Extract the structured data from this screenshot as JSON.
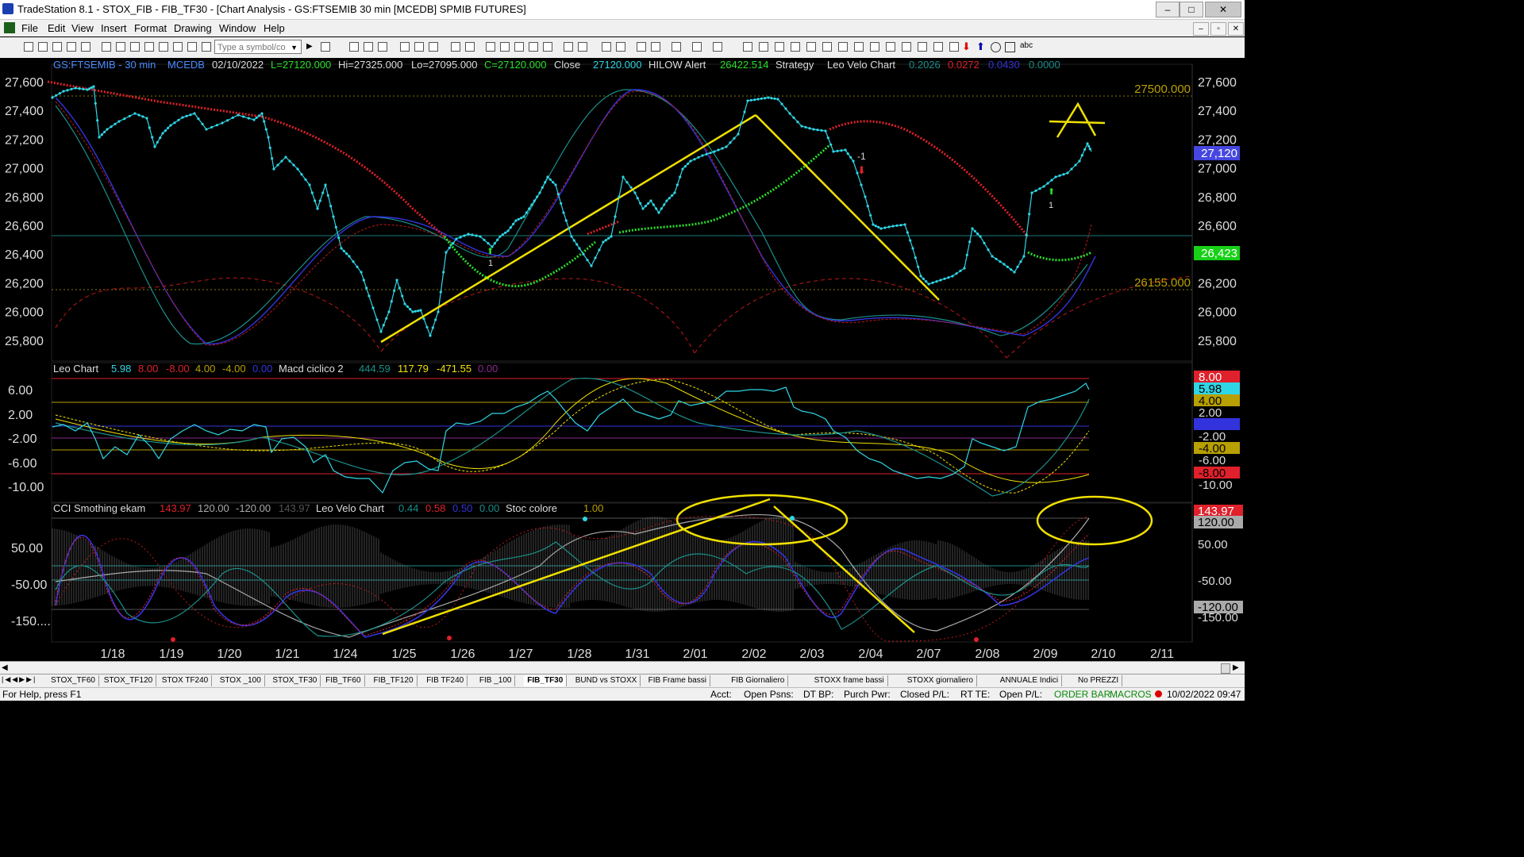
{
  "window": {
    "title": "TradeStation 8.1 - STOX_FIB - FIB_TF30 - [Chart Analysis - GS:FTSEMIB  30 min  [MCEDB] SPMIB FUTURES]",
    "min": "–",
    "max": "□",
    "close": "✕"
  },
  "menu": [
    "File",
    "Edit",
    "View",
    "Insert",
    "Format",
    "Drawing",
    "Window",
    "Help"
  ],
  "toolbar": {
    "symbol_placeholder": "Type a symbol/co",
    "abc": "abc"
  },
  "header": {
    "symbol": "GS:FTSEMIB - 30 min",
    "data": "MCEDB",
    "date": "02/10/2022",
    "last": "L=27120.000",
    "hi": "Hi=27325.000",
    "lo": "Lo=27095.000",
    "close_val": "C=27120.000",
    "close_label": "Close",
    "close_num": "27120.000",
    "hilow": "HILOW Alert",
    "hilow_val": "26422.514",
    "strategy": "Strategy",
    "leo_velo": "Leo Velo Chart",
    "v1": "0.2026",
    "v2": "0.0272",
    "v3": "0.0430",
    "v4": "0.0000"
  },
  "price_axis": [
    "27,600",
    "27,400",
    "27,200",
    "27,000",
    "26,800",
    "26,600",
    "26,400",
    "26,200",
    "26,000",
    "25,800"
  ],
  "price_axis_right": [
    "27,600",
    "27,400",
    "27,200",
    "27,000",
    "26,800",
    "26,600",
    "26,400",
    "26,200",
    "26,000",
    "25,800"
  ],
  "price_tags": {
    "last": "27,120",
    "green": "26,423"
  },
  "levels": {
    "upper": "27500.000",
    "lower": "26155.000"
  },
  "markers": {
    "minus1": "-1",
    "one_a": "1",
    "one_b": "1"
  },
  "annotation": {
    "letter": "A"
  },
  "mid_header": {
    "leo": "Leo Chart",
    "v1": "5.98",
    "v2": "8.00",
    "v3": "-8.00",
    "v4": "4.00",
    "v5": "-4.00",
    "v6": "0.00",
    "macd": "Macd ciclico 2",
    "m1": "444.59",
    "m2": "117.79",
    "m3": "-471.55",
    "m4": "0.00"
  },
  "mid_axis": [
    "6.00",
    "2.00",
    "-2.00",
    "-6.00",
    "-10.00"
  ],
  "mid_right_tags": [
    "8.00",
    "5.98",
    "4.00",
    "2.00",
    "0.00",
    "-2.00",
    "-4.00",
    "-6.00",
    "-8.00",
    "-10.00"
  ],
  "low_header": {
    "cci": "CCI Smothing ekam",
    "c1": "143.97",
    "c2": "120.00",
    "c3": "-120.00",
    "c4": "143.97",
    "leo": "Leo Velo Chart",
    "l1": "0.44",
    "l2": "0.58",
    "l3": "0.50",
    "l4": "0.00",
    "stoc": "Stoc colore",
    "s1": "1.00"
  },
  "low_axis": [
    "50.00",
    "-50.00",
    "-150...."
  ],
  "low_right_tags": [
    "143.97",
    "120.00",
    "50.00",
    "-50.00",
    "-120.00",
    "-150.00"
  ],
  "dates": [
    "1/18",
    "1/19",
    "1/20",
    "1/21",
    "1/24",
    "1/25",
    "1/26",
    "1/27",
    "1/28",
    "1/31",
    "2/01",
    "2/02",
    "2/03",
    "2/04",
    "2/07",
    "2/08",
    "2/09",
    "2/10",
    "2/11"
  ],
  "tabs": [
    "STOX_TF60",
    "STOX_TF120",
    "STOX TF240",
    "STOX _100",
    "STOX_TF30",
    "FIB_TF60",
    "FIB_TF120",
    "FIB TF240",
    "FIB _100",
    "FIB_TF30",
    "BUND vs STOXX",
    "FIB Frame bassi",
    "FIB Giornaliero",
    "STOXX frame bassi",
    "STOXX giornaliero",
    "ANNUALE Indici",
    "No PREZZI"
  ],
  "active_tab": "FIB_TF30",
  "status": {
    "help": "For Help, press F1",
    "acct": "Acct:",
    "open_psns": "Open Psns:",
    "dt_bp": "DT BP:",
    "purch": "Purch Pwr:",
    "closed": "Closed P/L:",
    "rt": "RT TE:",
    "open_pl": "Open P/L:",
    "order": "ORDER BAR",
    "macros": "MACROS",
    "datetime": "10/02/2022 09:47"
  },
  "colors": {
    "cyan": "#2fd6e6",
    "red": "#e0202a",
    "green": "#28e028",
    "yellow": "#f0e000",
    "blue": "#3333dd",
    "teal": "#1a8f8a",
    "gold": "#b8a000"
  }
}
